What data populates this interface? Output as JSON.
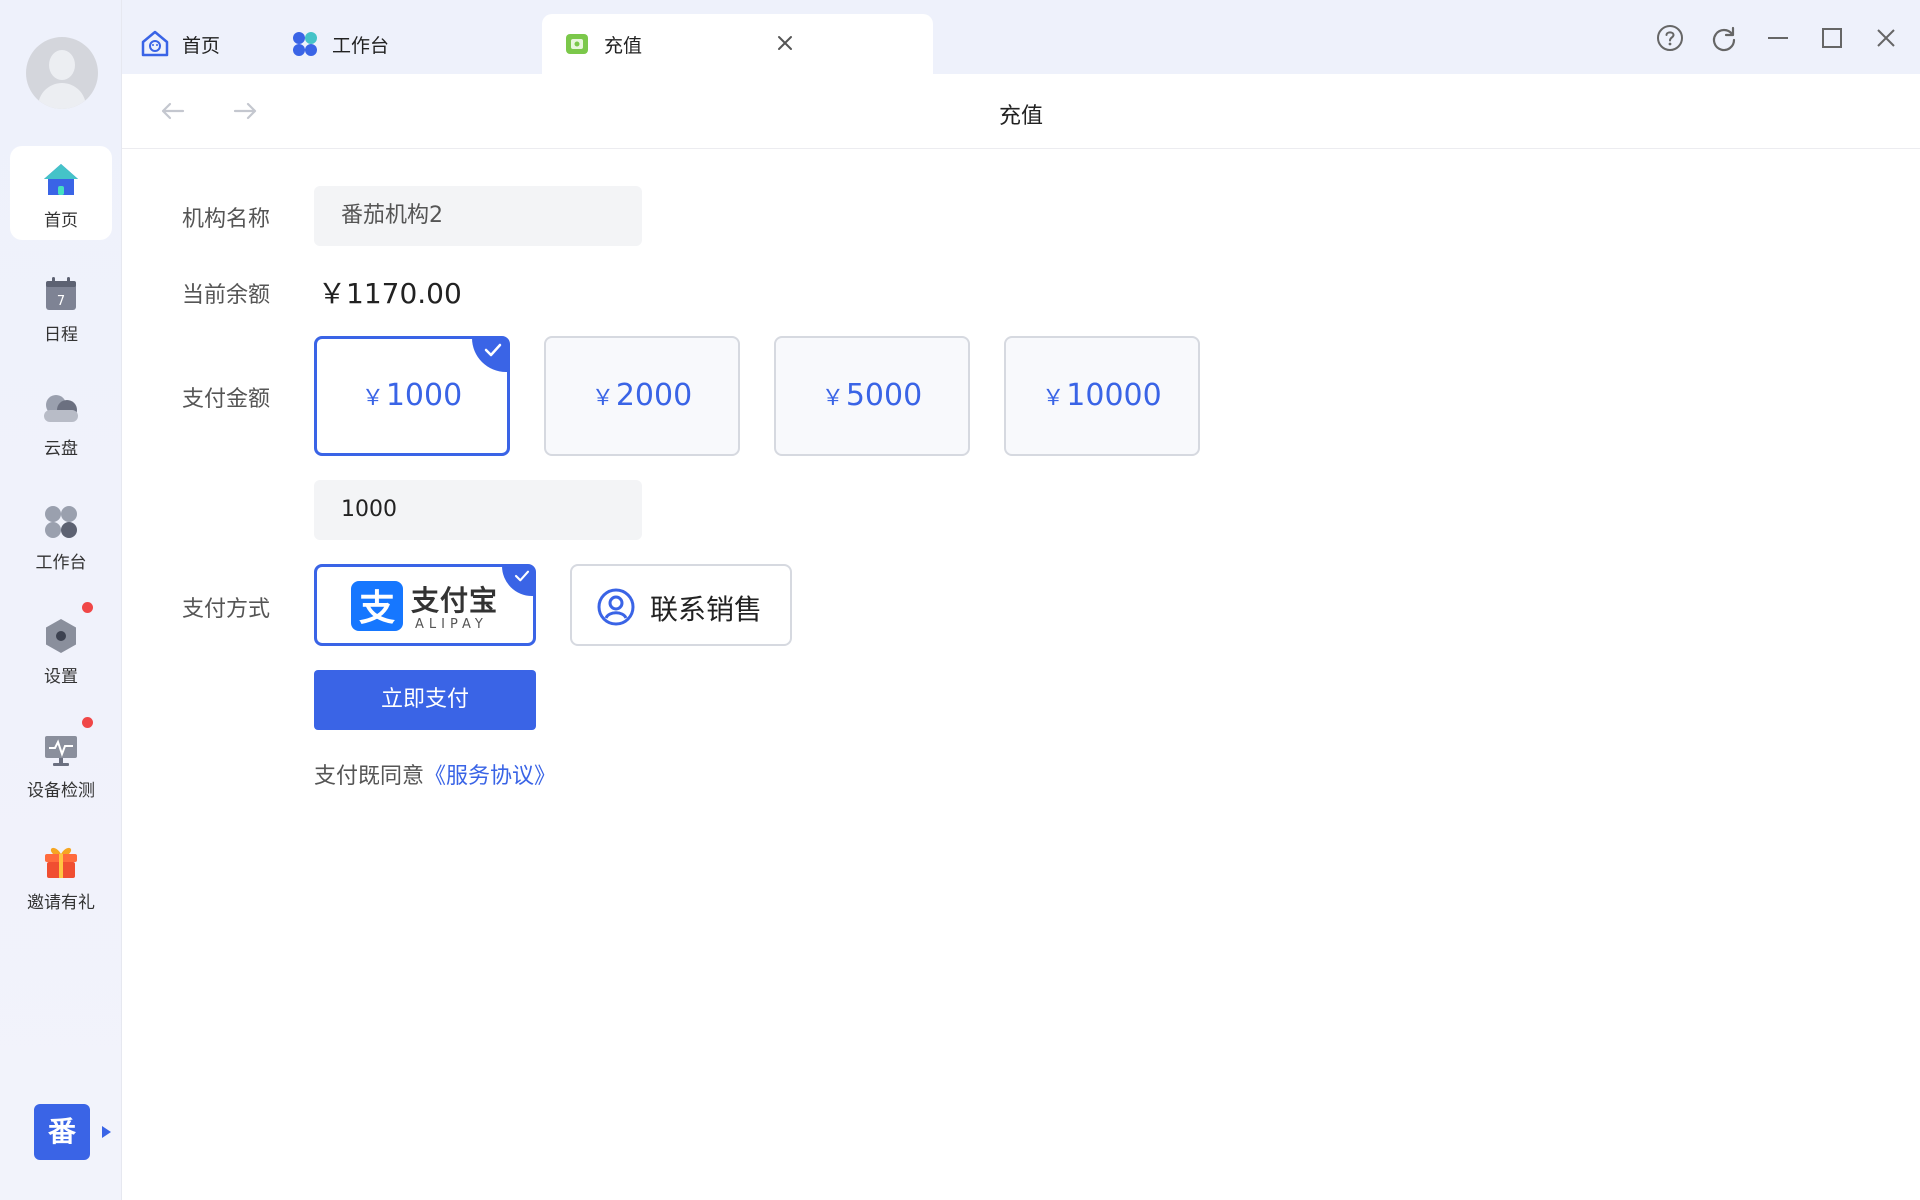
{
  "sidebar": {
    "items": [
      {
        "label": "首页",
        "icon": "home-icon"
      },
      {
        "label": "日程",
        "icon": "calendar-icon"
      },
      {
        "label": "云盘",
        "icon": "cloud-icon"
      },
      {
        "label": "工作台",
        "icon": "apps-icon"
      },
      {
        "label": "设置",
        "icon": "settings-icon"
      },
      {
        "label": "设备检测",
        "icon": "monitor-icon"
      },
      {
        "label": "邀请有礼",
        "icon": "gift-icon"
      }
    ],
    "calendar_day": "7",
    "brand_char": "番"
  },
  "tabs": [
    {
      "label": "首页",
      "icon": "home-icon"
    },
    {
      "label": "工作台",
      "icon": "apps-icon"
    },
    {
      "label": "充值",
      "icon": "wallet-icon"
    }
  ],
  "header": {
    "title": "充值"
  },
  "form": {
    "org_label": "机构名称",
    "org_value": "番茄机构2",
    "balance_label": "当前余额",
    "balance_value": "￥1170.00",
    "amount_label": "支付金额",
    "currency": "￥",
    "amounts": [
      "1000",
      "2000",
      "5000",
      "10000"
    ],
    "selected_amount": "1000",
    "custom_amount": "1000",
    "method_label": "支付方式",
    "alipay_cn": "支付宝",
    "alipay_en": "ALIPAY",
    "contact_sales": "联系销售",
    "pay_button": "立即支付",
    "agree_text": "支付既同意",
    "agreement_link": "《服务协议》"
  },
  "colors": {
    "accent": "#3a64e6",
    "alert": "#f04747"
  }
}
